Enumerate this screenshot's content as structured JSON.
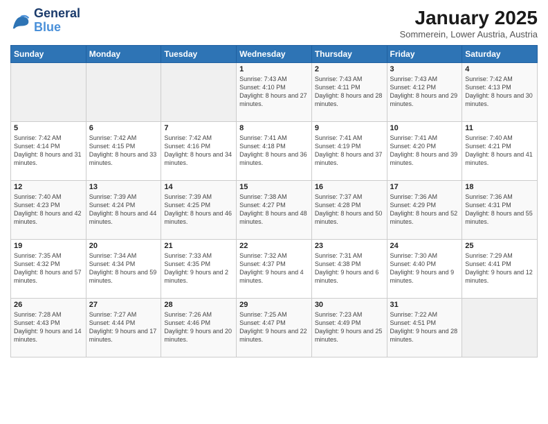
{
  "header": {
    "logo_line1": "General",
    "logo_line2": "Blue",
    "month": "January 2025",
    "location": "Sommerein, Lower Austria, Austria"
  },
  "weekdays": [
    "Sunday",
    "Monday",
    "Tuesday",
    "Wednesday",
    "Thursday",
    "Friday",
    "Saturday"
  ],
  "weeks": [
    [
      {
        "day": "",
        "info": ""
      },
      {
        "day": "",
        "info": ""
      },
      {
        "day": "",
        "info": ""
      },
      {
        "day": "1",
        "info": "Sunrise: 7:43 AM\nSunset: 4:10 PM\nDaylight: 8 hours and 27 minutes."
      },
      {
        "day": "2",
        "info": "Sunrise: 7:43 AM\nSunset: 4:11 PM\nDaylight: 8 hours and 28 minutes."
      },
      {
        "day": "3",
        "info": "Sunrise: 7:43 AM\nSunset: 4:12 PM\nDaylight: 8 hours and 29 minutes."
      },
      {
        "day": "4",
        "info": "Sunrise: 7:42 AM\nSunset: 4:13 PM\nDaylight: 8 hours and 30 minutes."
      }
    ],
    [
      {
        "day": "5",
        "info": "Sunrise: 7:42 AM\nSunset: 4:14 PM\nDaylight: 8 hours and 31 minutes."
      },
      {
        "day": "6",
        "info": "Sunrise: 7:42 AM\nSunset: 4:15 PM\nDaylight: 8 hours and 33 minutes."
      },
      {
        "day": "7",
        "info": "Sunrise: 7:42 AM\nSunset: 4:16 PM\nDaylight: 8 hours and 34 minutes."
      },
      {
        "day": "8",
        "info": "Sunrise: 7:41 AM\nSunset: 4:18 PM\nDaylight: 8 hours and 36 minutes."
      },
      {
        "day": "9",
        "info": "Sunrise: 7:41 AM\nSunset: 4:19 PM\nDaylight: 8 hours and 37 minutes."
      },
      {
        "day": "10",
        "info": "Sunrise: 7:41 AM\nSunset: 4:20 PM\nDaylight: 8 hours and 39 minutes."
      },
      {
        "day": "11",
        "info": "Sunrise: 7:40 AM\nSunset: 4:21 PM\nDaylight: 8 hours and 41 minutes."
      }
    ],
    [
      {
        "day": "12",
        "info": "Sunrise: 7:40 AM\nSunset: 4:23 PM\nDaylight: 8 hours and 42 minutes."
      },
      {
        "day": "13",
        "info": "Sunrise: 7:39 AM\nSunset: 4:24 PM\nDaylight: 8 hours and 44 minutes."
      },
      {
        "day": "14",
        "info": "Sunrise: 7:39 AM\nSunset: 4:25 PM\nDaylight: 8 hours and 46 minutes."
      },
      {
        "day": "15",
        "info": "Sunrise: 7:38 AM\nSunset: 4:27 PM\nDaylight: 8 hours and 48 minutes."
      },
      {
        "day": "16",
        "info": "Sunrise: 7:37 AM\nSunset: 4:28 PM\nDaylight: 8 hours and 50 minutes."
      },
      {
        "day": "17",
        "info": "Sunrise: 7:36 AM\nSunset: 4:29 PM\nDaylight: 8 hours and 52 minutes."
      },
      {
        "day": "18",
        "info": "Sunrise: 7:36 AM\nSunset: 4:31 PM\nDaylight: 8 hours and 55 minutes."
      }
    ],
    [
      {
        "day": "19",
        "info": "Sunrise: 7:35 AM\nSunset: 4:32 PM\nDaylight: 8 hours and 57 minutes."
      },
      {
        "day": "20",
        "info": "Sunrise: 7:34 AM\nSunset: 4:34 PM\nDaylight: 8 hours and 59 minutes."
      },
      {
        "day": "21",
        "info": "Sunrise: 7:33 AM\nSunset: 4:35 PM\nDaylight: 9 hours and 2 minutes."
      },
      {
        "day": "22",
        "info": "Sunrise: 7:32 AM\nSunset: 4:37 PM\nDaylight: 9 hours and 4 minutes."
      },
      {
        "day": "23",
        "info": "Sunrise: 7:31 AM\nSunset: 4:38 PM\nDaylight: 9 hours and 6 minutes."
      },
      {
        "day": "24",
        "info": "Sunrise: 7:30 AM\nSunset: 4:40 PM\nDaylight: 9 hours and 9 minutes."
      },
      {
        "day": "25",
        "info": "Sunrise: 7:29 AM\nSunset: 4:41 PM\nDaylight: 9 hours and 12 minutes."
      }
    ],
    [
      {
        "day": "26",
        "info": "Sunrise: 7:28 AM\nSunset: 4:43 PM\nDaylight: 9 hours and 14 minutes."
      },
      {
        "day": "27",
        "info": "Sunrise: 7:27 AM\nSunset: 4:44 PM\nDaylight: 9 hours and 17 minutes."
      },
      {
        "day": "28",
        "info": "Sunrise: 7:26 AM\nSunset: 4:46 PM\nDaylight: 9 hours and 20 minutes."
      },
      {
        "day": "29",
        "info": "Sunrise: 7:25 AM\nSunset: 4:47 PM\nDaylight: 9 hours and 22 minutes."
      },
      {
        "day": "30",
        "info": "Sunrise: 7:23 AM\nSunset: 4:49 PM\nDaylight: 9 hours and 25 minutes."
      },
      {
        "day": "31",
        "info": "Sunrise: 7:22 AM\nSunset: 4:51 PM\nDaylight: 9 hours and 28 minutes."
      },
      {
        "day": "",
        "info": ""
      }
    ]
  ]
}
